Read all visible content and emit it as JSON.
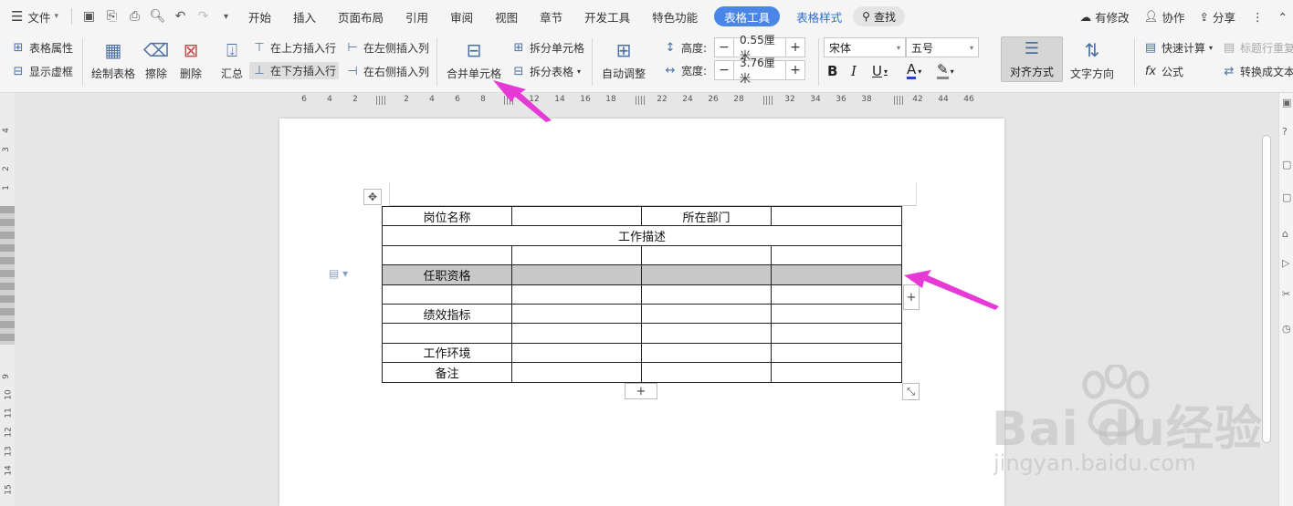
{
  "menubar": {
    "file": "文件",
    "tabs": [
      "开始",
      "插入",
      "页面布局",
      "引用",
      "审阅",
      "视图",
      "章节",
      "开发工具",
      "特色功能"
    ],
    "active_tab": "表格工具",
    "style_tab": "表格样式",
    "search": "查找",
    "right": {
      "changes": "有修改",
      "collab": "协作",
      "share": "分享"
    }
  },
  "ribbon": {
    "table_props": "表格属性",
    "show_gridlines": "显示虚框",
    "draw_table": "绘制表格",
    "erase": "擦除",
    "delete": "删除",
    "summary": "汇总",
    "insert_row_above": "在上方插入行",
    "insert_row_below": "在下方插入行",
    "insert_col_left": "在左侧插入列",
    "insert_col_right": "在右侧插入列",
    "merge_cells": "合并单元格",
    "split_cells": "拆分单元格",
    "split_table": "拆分表格",
    "auto_fit": "自动调整",
    "height_label": "高度:",
    "height_value": "0.55厘米",
    "width_label": "宽度:",
    "width_value": "3.76厘米",
    "font": "宋体",
    "font_size": "五号",
    "align": "对齐方式",
    "text_dir": "文字方向",
    "quick_calc": "快速计算",
    "repeat_header": "标题行重复",
    "formula": "公式",
    "to_text": "转换成文本"
  },
  "ruler": {
    "ticks": [
      "6",
      "4",
      "2",
      "2",
      "4",
      "6",
      "8",
      "12",
      "14",
      "16",
      "18",
      "22",
      "24",
      "26",
      "28",
      "32",
      "34",
      "36",
      "38",
      "42",
      "44",
      "46"
    ]
  },
  "vruler": {
    "ticks": [
      "4",
      "3",
      "2",
      "1",
      "9",
      "10",
      "11",
      "12",
      "13",
      "14",
      "15"
    ]
  },
  "table": {
    "row1": {
      "c1": "岗位名称",
      "c2": "",
      "c3": "所在部门",
      "c4": ""
    },
    "row2": "工作描述",
    "row4": "任职资格",
    "row6": "绩效指标",
    "row8": "工作环境",
    "row9": "备注"
  },
  "watermark": {
    "logo": "Bai   du经验",
    "url": "jingyan.baidu.com"
  },
  "colors": {
    "accent": "#4a86e8",
    "highlight_row": "#c8c8c8",
    "arrow": "#e63ad6"
  }
}
